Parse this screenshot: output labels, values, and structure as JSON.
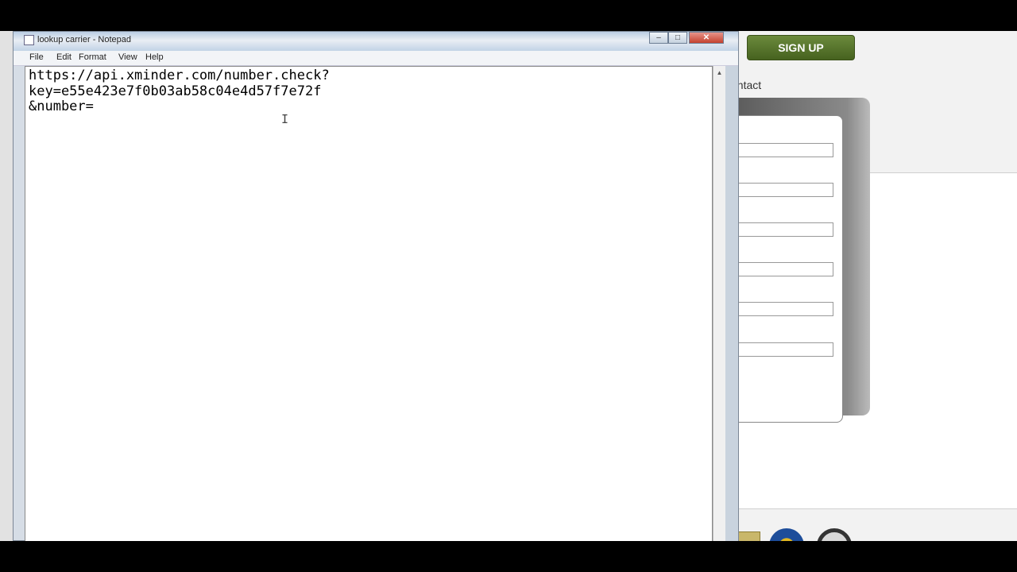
{
  "notepad": {
    "title": "lookup carrier - Notepad",
    "menu": [
      "File",
      "Edit",
      "Format",
      "View",
      "Help"
    ],
    "window_buttons": {
      "minimize": "–",
      "maximize": "□",
      "close": "✕"
    },
    "content": "https://api.xminder.com/number.check?\nkey=e55e423e7f0b03ab58c04e4d57f7e72f\n&number="
  },
  "background_site": {
    "signup_label": "SIGN UP",
    "contact_label": "ontact",
    "form_field_count": 6
  },
  "colors": {
    "signup_green": "#4f6d27",
    "desktop_black": "#000000"
  },
  "icons": [
    "notepad-app-icon",
    "text-cursor-icon",
    "scroll-up-arrow-icon"
  ]
}
